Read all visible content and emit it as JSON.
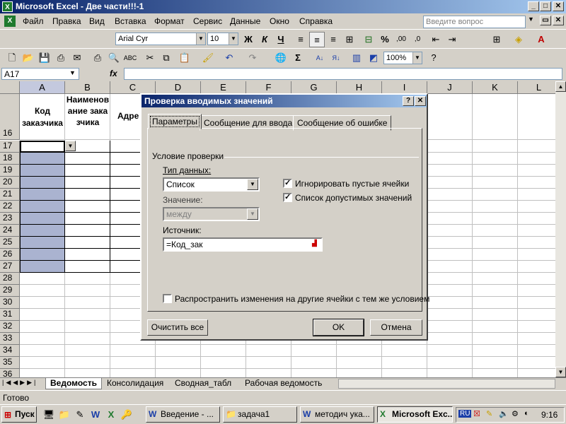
{
  "window": {
    "title": "Microsoft Excel - Две части!!!-1"
  },
  "menu": [
    "Файл",
    "Правка",
    "Вид",
    "Вставка",
    "Формат",
    "Сервис",
    "Данные",
    "Окно",
    "Справка"
  ],
  "ask_placeholder": "Введите вопрос",
  "toolbar": {
    "font": "Arial Cyr",
    "size": "10",
    "zoom": "100%",
    "bold": "Ж",
    "italic": "К",
    "underline": "Ч",
    "percent": "%",
    "sigma": "Σ"
  },
  "formula_bar": {
    "name_box": "A17",
    "fx": "fx"
  },
  "columns": [
    "A",
    "B",
    "C",
    "D",
    "E",
    "F",
    "G",
    "H",
    "I",
    "J",
    "K",
    "L"
  ],
  "rows": [
    "16",
    "17",
    "18",
    "19",
    "20",
    "21",
    "22",
    "23",
    "24",
    "25",
    "26",
    "27",
    "28",
    "29",
    "30",
    "31",
    "32",
    "33",
    "34",
    "35",
    "36"
  ],
  "headers": {
    "a16": "Код заказчика",
    "b16": "Наименование заказчика",
    "c16": "Адре"
  },
  "sheet_tabs": [
    "Ведомость",
    "Консолидация",
    "Сводная_табл",
    "Рабочая ведомость"
  ],
  "status": "Готово",
  "taskbar": {
    "start": "Пуск",
    "tasks": [
      "Введение - ...",
      "задача1",
      "методич ука...",
      "Microsoft Exc..."
    ],
    "lang": "RU",
    "clock": "9:16"
  },
  "dialog": {
    "title": "Проверка вводимых значений",
    "help": "?",
    "close": "✕",
    "tabs": [
      "Параметры",
      "Сообщение для ввода",
      "Сообщение об ошибке"
    ],
    "group_label": "Условие проверки",
    "data_type_label": "Тип данных:",
    "data_type_value": "Список",
    "value_label": "Значение:",
    "value_value": "между",
    "ignore_blank": "Игнорировать пустые ячейки",
    "in_cell_dropdown": "Список допустимых значений",
    "source_label": "Источник:",
    "source_value": "=Код_зак",
    "apply_all": "Распространить изменения на другие ячейки с тем же условием",
    "clear_all": "Очистить все",
    "ok": "OK",
    "cancel": "Отмена"
  }
}
